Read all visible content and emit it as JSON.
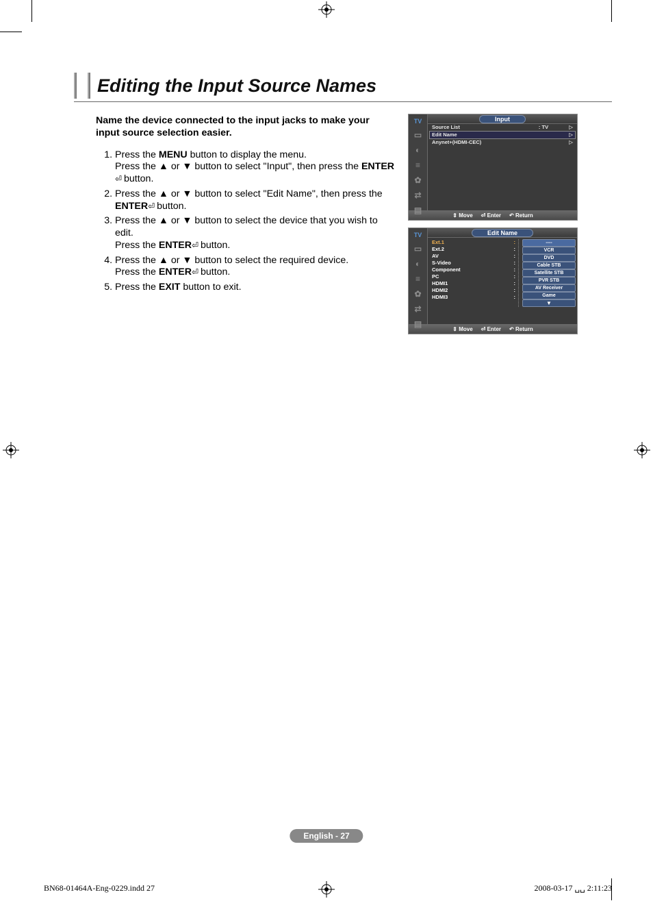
{
  "title": "Editing the Input Source Names",
  "intro": "Name the device connected to the input jacks to make your input source selection easier.",
  "steps": {
    "s1a": "Press the ",
    "s1_menu": "MENU",
    "s1b": " button to display the menu.",
    "s1c": "Press the ▲ or ▼ button to select \"Input\", then press the ",
    "s1_enter": "ENTER",
    "s1d": " button.",
    "s2a": "Press the ▲ or ▼ button to select \"Edit Name\", then press the ",
    "s2_enter": "ENTER",
    "s2b": " button.",
    "s3a": "Press the ▲ or ▼ button to select the device that you wish to edit.",
    "s3b": "Press the ",
    "s3_enter": "ENTER",
    "s3c": " button.",
    "s4a": "Press the ▲ or ▼ button to select the required device.",
    "s4b": "Press the ",
    "s4_enter": "ENTER",
    "s4c": " button.",
    "s5a": "Press the ",
    "s5_exit": "EXIT",
    "s5b": " button to exit."
  },
  "osd1": {
    "side_label": "TV",
    "title": "Input",
    "rows": [
      {
        "lbl": "Source List",
        "val": ":   TV",
        "sel": false
      },
      {
        "lbl": "Edit Name",
        "val": "",
        "sel": true
      },
      {
        "lbl": "Anynet+(HDMI-CEC)",
        "val": "",
        "sel": false
      }
    ],
    "footer": {
      "move": "Move",
      "enter": "Enter",
      "return": "Return"
    }
  },
  "osd2": {
    "side_label": "TV",
    "title": "Edit Name",
    "sources": [
      "Ext.1",
      "Ext.2",
      "AV",
      "S-Video",
      "Component",
      "PC",
      "HDMI1",
      "HDMI2",
      "HDMI3"
    ],
    "sel_source_index": 0,
    "options": [
      "----",
      "VCR",
      "DVD",
      "Cable STB",
      "Satellite STB",
      "PVR STB",
      "AV Receiver",
      "Game",
      "▼"
    ],
    "sel_option_index": 0,
    "footer": {
      "move": "Move",
      "enter": "Enter",
      "return": "Return"
    }
  },
  "page_badge": "English - 27",
  "footer_left": "BN68-01464A-Eng-0229.indd   27",
  "footer_right": "2008-03-17   ␣␣ 2:11:23"
}
